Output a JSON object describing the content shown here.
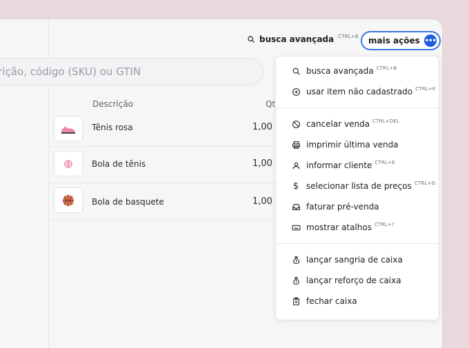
{
  "topbar": {
    "advanced_search_label": "busca avançada",
    "advanced_search_shortcut": "CTRL+B",
    "more_actions_label": "mais ações"
  },
  "search": {
    "placeholder": "crição, código (SKU) ou GTIN"
  },
  "table": {
    "headers": {
      "description": "Descrição",
      "quantity": "Qt"
    },
    "rows": [
      {
        "description": "Tênis rosa",
        "quantity": "1,00"
      },
      {
        "description": "Bola de tênis",
        "quantity": "1,00"
      },
      {
        "description": "Bola de basquete",
        "quantity": "1,00"
      }
    ]
  },
  "menu": {
    "groups": [
      [
        {
          "label": "busca avançada",
          "shortcut": "CTRL+B",
          "icon": "search-icon"
        },
        {
          "label": "usar item não cadastrado",
          "shortcut": "CTRL+K",
          "icon": "plus-circle-icon"
        }
      ],
      [
        {
          "label": "cancelar venda",
          "shortcut": "CTRL+DEL",
          "icon": "ban-icon"
        },
        {
          "label": "imprimir última venda",
          "shortcut": "",
          "icon": "printer-icon"
        },
        {
          "label": "informar cliente",
          "shortcut": "CTRL+E",
          "icon": "user-icon"
        },
        {
          "label": "selecionar lista de preços",
          "shortcut": "CTRL+G",
          "icon": "dollar-icon"
        },
        {
          "label": "faturar pré-venda",
          "shortcut": "",
          "icon": "inbox-icon"
        },
        {
          "label": "mostrar atalhos",
          "shortcut": "CTRL+?",
          "icon": "keyboard-icon"
        }
      ],
      [
        {
          "label": "lançar sangria de caixa",
          "shortcut": "",
          "icon": "money-bag-icon"
        },
        {
          "label": "lançar reforço de caixa",
          "shortcut": "",
          "icon": "money-bag-icon"
        },
        {
          "label": "fechar caixa",
          "shortcut": "",
          "icon": "clipboard-icon"
        }
      ]
    ]
  },
  "colors": {
    "background": "#ead9dc",
    "accent": "#1f5ee0",
    "accent_border": "#3a73e6"
  }
}
